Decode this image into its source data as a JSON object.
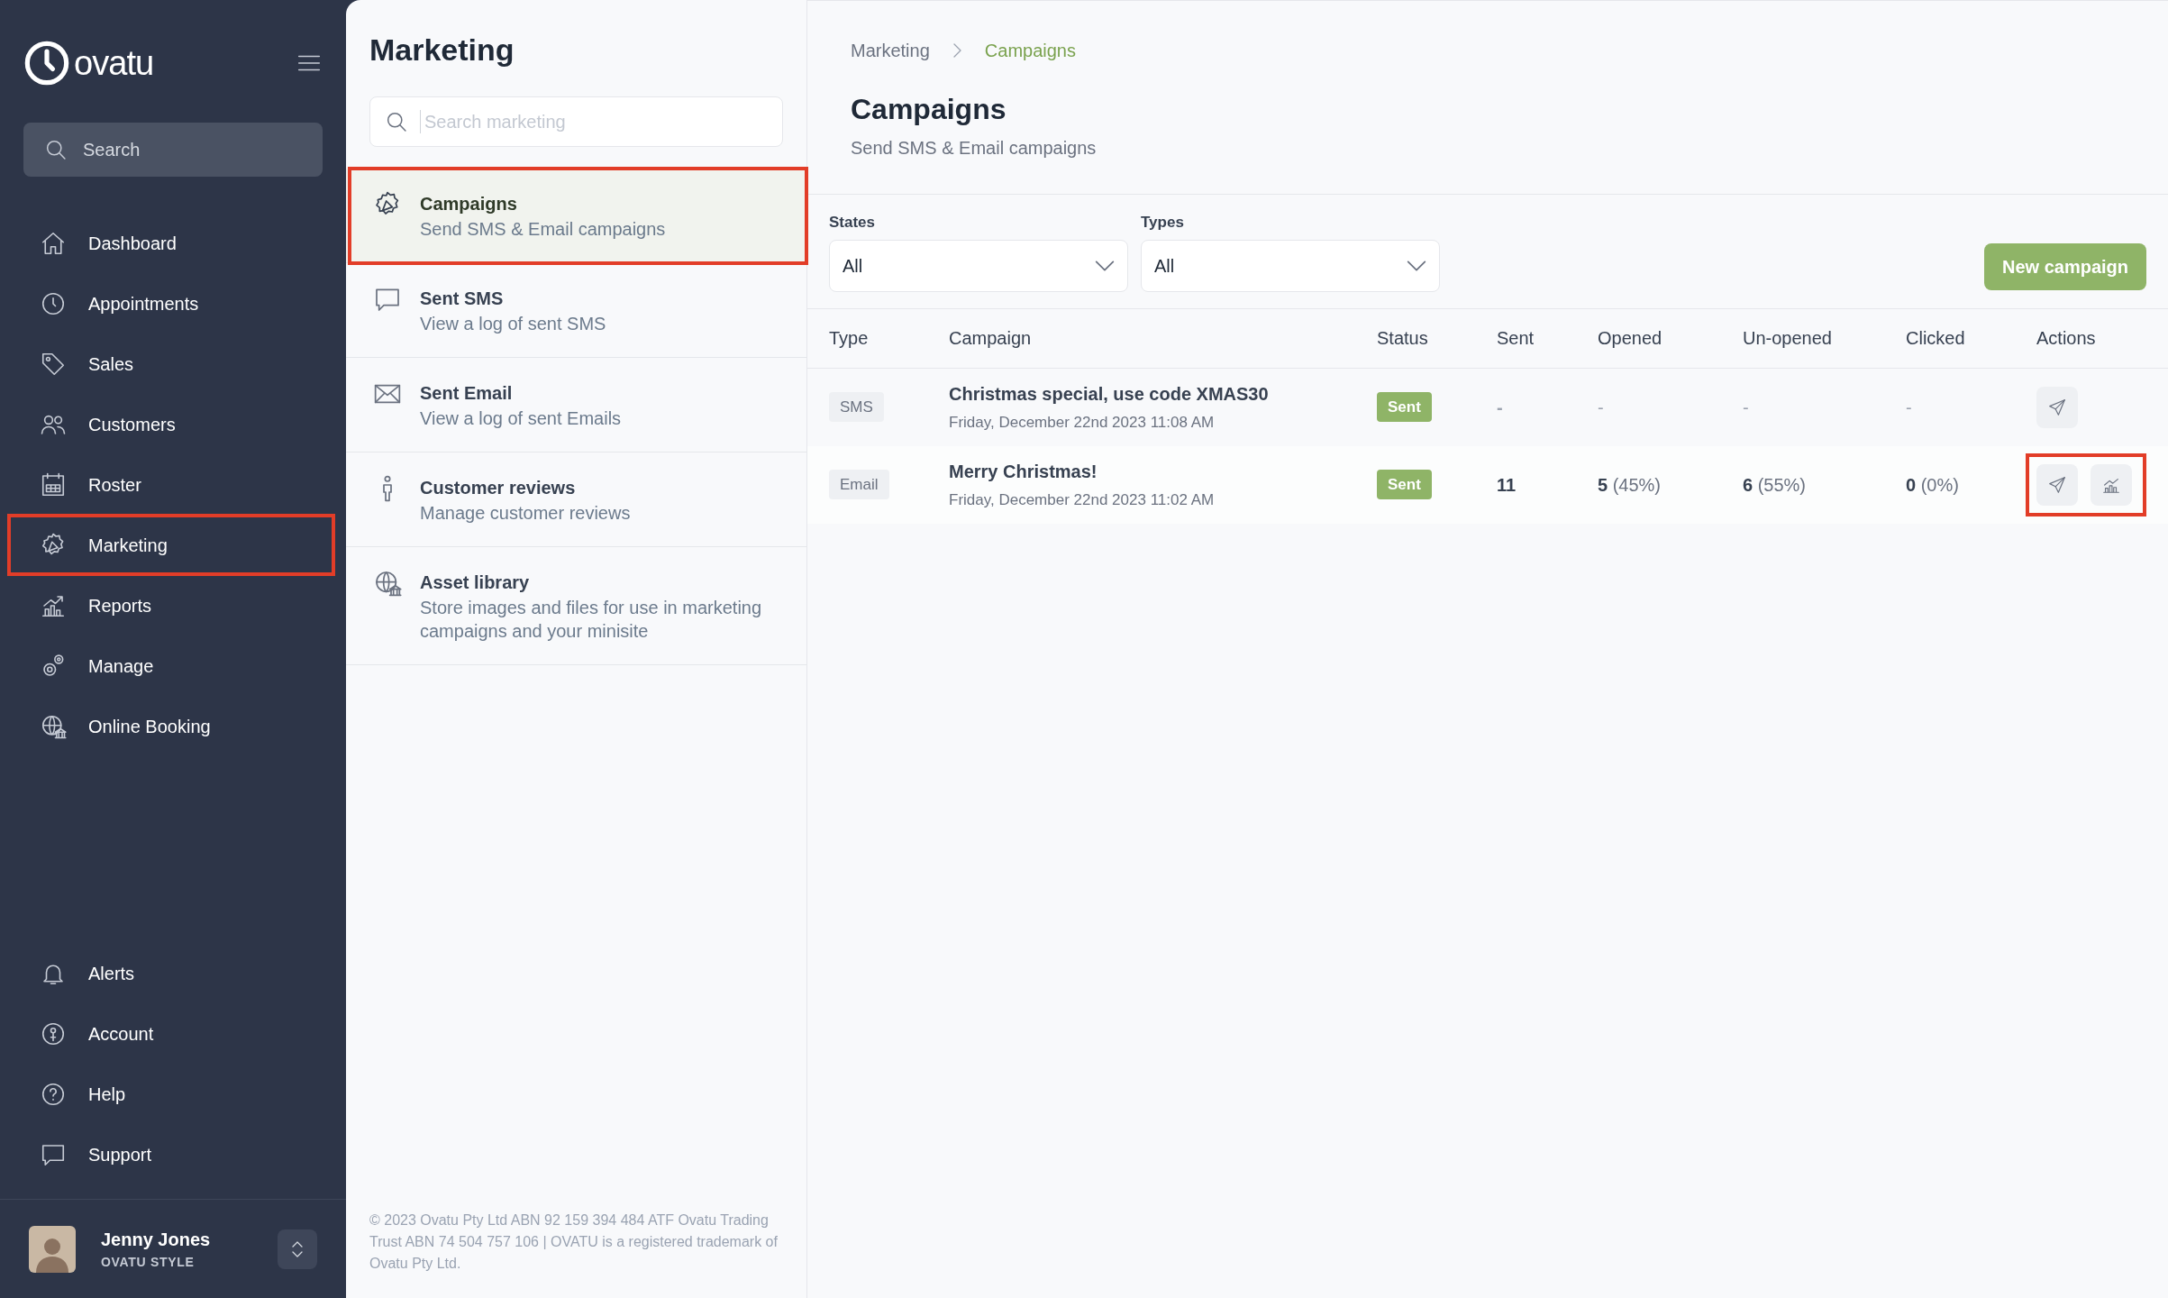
{
  "sidebar": {
    "logo": "ovatu",
    "search": {
      "placeholder": "Search"
    },
    "items": [
      {
        "label": "Dashboard",
        "highlighted": false
      },
      {
        "label": "Appointments",
        "highlighted": false
      },
      {
        "label": "Sales",
        "highlighted": false
      },
      {
        "label": "Customers",
        "highlighted": false
      },
      {
        "label": "Roster",
        "highlighted": false
      },
      {
        "label": "Marketing",
        "highlighted": true
      },
      {
        "label": "Reports",
        "highlighted": false
      },
      {
        "label": "Manage",
        "highlighted": false
      },
      {
        "label": "Online Booking",
        "highlighted": false
      }
    ],
    "bottom_items": [
      {
        "label": "Alerts"
      },
      {
        "label": "Account"
      },
      {
        "label": "Help"
      },
      {
        "label": "Support"
      }
    ],
    "user": {
      "name": "Jenny Jones",
      "business": "OVATU STYLE"
    }
  },
  "menu": {
    "title": "Marketing",
    "search": {
      "placeholder": "Search marketing"
    },
    "items": [
      {
        "title": "Campaigns",
        "subtitle": "Send SMS & Email campaigns",
        "selected": true,
        "highlighted": true
      },
      {
        "title": "Sent SMS",
        "subtitle": "View a log of sent SMS",
        "selected": false,
        "highlighted": false
      },
      {
        "title": "Sent Email",
        "subtitle": "View a log of sent Emails",
        "selected": false,
        "highlighted": false
      },
      {
        "title": "Customer reviews",
        "subtitle": "Manage customer reviews",
        "selected": false,
        "highlighted": false
      },
      {
        "title": "Asset library",
        "subtitle": "Store images and files for use in marketing campaigns and your minisite",
        "selected": false,
        "highlighted": false
      }
    ],
    "footer": "© 2023 Ovatu Pty Ltd ABN 92 159 394 484 ATF Ovatu Trading Trust ABN 74 504 757 106 | OVATU is a registered trademark of Ovatu Pty Ltd."
  },
  "main": {
    "breadcrumb": [
      "Marketing",
      "Campaigns"
    ],
    "title": "Campaigns",
    "subtitle": "Send SMS & Email campaigns",
    "filters": [
      {
        "label": "States",
        "value": "All"
      },
      {
        "label": "Types",
        "value": "All"
      }
    ],
    "new_button": "New campaign",
    "table": {
      "columns": [
        "Type",
        "Campaign",
        "Status",
        "Sent",
        "Opened",
        "Un-opened",
        "Clicked",
        "Actions"
      ],
      "rows": [
        {
          "type": "SMS",
          "campaign": "Christmas special, use code XMAS30",
          "date": "Friday, December 22nd 2023 11:08 AM",
          "status": "Sent",
          "sent": "-",
          "opened": "-",
          "unopened": "-",
          "clicked": "-",
          "actions": [
            {
              "kind": "send"
            }
          ],
          "highlighted": false
        },
        {
          "type": "Email",
          "campaign": "Merry Christmas!",
          "date": "Friday, December 22nd 2023 11:02 AM",
          "status": "Sent",
          "sent": "11",
          "opened": "**5** (45%)",
          "unopened": "**6** (55%)",
          "clicked": "**0** (0%)",
          "actions": [
            {
              "kind": "send"
            },
            {
              "kind": "stats"
            }
          ],
          "highlighted": true
        }
      ]
    }
  }
}
